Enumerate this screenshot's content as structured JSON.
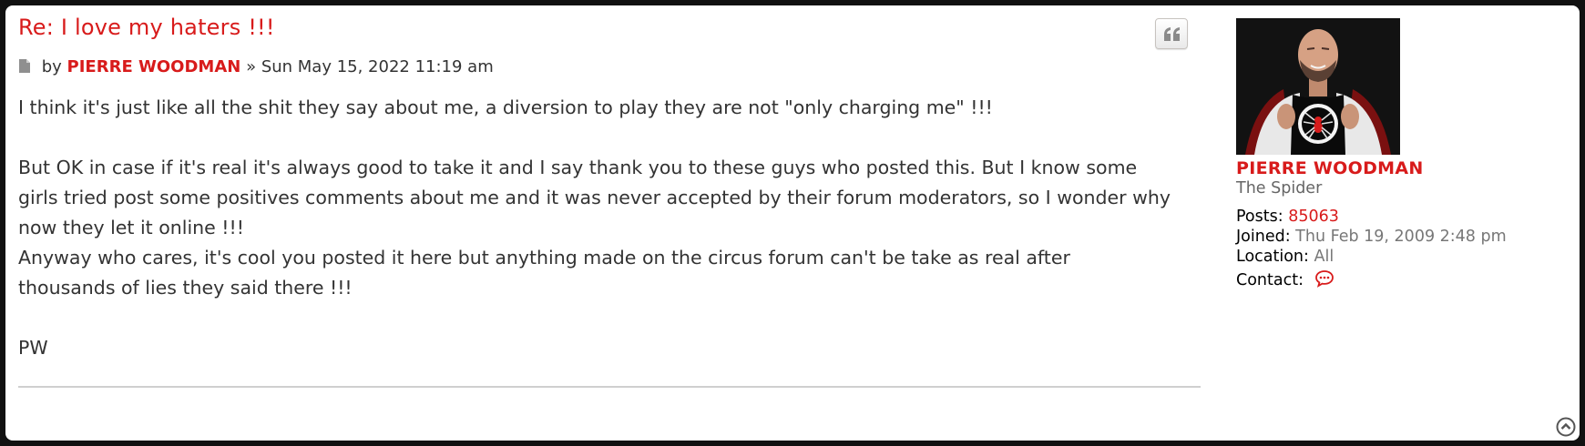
{
  "post": {
    "title": "Re: I love my haters !!!",
    "meta_by": "by",
    "author": "PIERRE WOODMAN",
    "meta_separator": "»",
    "date": "Sun May 15, 2022 11:19 am",
    "content_lines": [
      "I think it's just like all the shit they say about me, a diversion to play they are not \"only charging me\" !!!",
      "",
      "But OK in case if it's real it's always good to take it and I say thank you to these guys who posted this. But I know some",
      "girls tried post some positives comments about me and it was never accepted by their forum moderators, so I wonder why",
      "now they let it online !!!",
      "Anyway who cares, it's cool you posted it here but anything made on the circus forum can't be take as real after",
      "thousands of lies they said there !!!",
      "",
      "PW"
    ]
  },
  "profile": {
    "username": "PIERRE WOODMAN",
    "rank": "The Spider",
    "posts_label": "Posts:",
    "posts_value": "85063",
    "joined_label": "Joined:",
    "joined_value": "Thu Feb 19, 2009 2:48 pm",
    "location_label": "Location:",
    "location_value": "All",
    "contact_label": "Contact:"
  },
  "icons": {
    "quote": "quote-icon",
    "post": "document-icon",
    "contact": "speech-bubble-icon",
    "back_to_top": "chevron-up-circle-icon"
  },
  "colors": {
    "accent": "#d81b1b",
    "text": "#333333",
    "muted": "#777777"
  }
}
